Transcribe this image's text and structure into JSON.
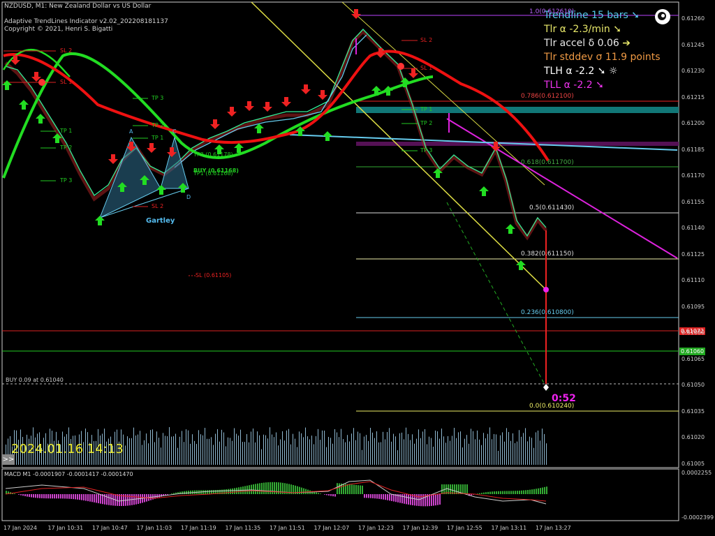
{
  "header": {
    "symbol_line": "NZDUSD, M1:  New Zealand Dollar vs US Dollar",
    "indicator_line": "Adaptive TrendLines Indicator v2.02_202208181137",
    "copyright_line": "Copyright © 2021, Henri S. Bigatti"
  },
  "indicator_panel": {
    "trendline": "Trendline 15 bars",
    "tlr": "Tlr α -2.3/min",
    "tlr_accel": "Tlr accel δ 0.06",
    "tlr_stddev": "Tlr stddev σ 11.9 points",
    "tlh": "TLH α -2.2",
    "tll": "TLL α -2.2"
  },
  "price_axis": [
    "0.61260",
    "0.61245",
    "0.61230",
    "0.61215",
    "0.61200",
    "0.61185",
    "0.61170",
    "0.61155",
    "0.61140",
    "0.61125",
    "0.61110",
    "0.61095",
    "0.61080",
    "0.61065",
    "0.61050",
    "0.61035",
    "0.61020",
    "0.61005"
  ],
  "price_tags": {
    "red": "0.61072",
    "green": "0.61060"
  },
  "macd_axis": {
    "top": "0.0002255",
    "bottom": "-0.0002399"
  },
  "time_axis": [
    "17 Jan 2024",
    "17 Jan 10:31",
    "17 Jan 10:47",
    "17 Jan 11:03",
    "17 Jan 11:19",
    "17 Jan 11:35",
    "17 Jan 11:51",
    "17 Jan 12:07",
    "17 Jan 12:23",
    "17 Jan 12:39",
    "17 Jan 12:55",
    "17 Jan 13:11",
    "17 Jan 13:27"
  ],
  "fibonacci": {
    "f100": "1.0(0.612610)",
    "f786": "0.786(0.612100)",
    "f618": "0.618(0.611700)",
    "f50": "0.5(0.611430)",
    "f382": "0.382(0.611150)",
    "f236": "0.236(0.610800)",
    "f0": "0.0(0.610240)"
  },
  "labels": {
    "sl2_top": "SL 2",
    "sl1_top": "SL 1",
    "tp3": "TP 3",
    "tp2": "TP 2",
    "tp1": "TP 1",
    "tp1_left": "TP 1",
    "tp2_left": "TP 2",
    "tp3_left": "TP 3",
    "sl2_bottom": "SL 2",
    "gartley": "Gartley",
    "pt_a": "A",
    "pt_b": "B",
    "pt_c": "C",
    "pt_d": "D",
    "tp_mid_a": "TP2 (0.61178)",
    "buy_mid": "BUY (0.61168)",
    "tp_mid_b": "TP1 (0.61168)",
    "sl_mid": "SL (0.61105)",
    "sl2_right": "SL 2",
    "sl1_right": "SL 1",
    "tp1_right": "TP 1",
    "tp2_right": "TP 2",
    "tp3_right": "TP 3",
    "buy_order": "BUY 0.09 at 0.61040",
    "timer": "0:52",
    "datetime": "2024.01.16 14:13",
    "macd": "MACD M1 -0.0001907 -0.0001417 -0.0001470",
    "expand_btn": ">>"
  },
  "colors": {
    "background": "#000000",
    "bull_arrow": "#22dd22",
    "bear_arrow": "#ee2222",
    "ma_red": "#ee1111",
    "ma_green": "#22dd22",
    "teal_band": "#117777",
    "purple_band": "#551155",
    "magenta": "#dd22dd",
    "cyan_line": "#66ccee",
    "yellow_line": "#dddd44"
  }
}
